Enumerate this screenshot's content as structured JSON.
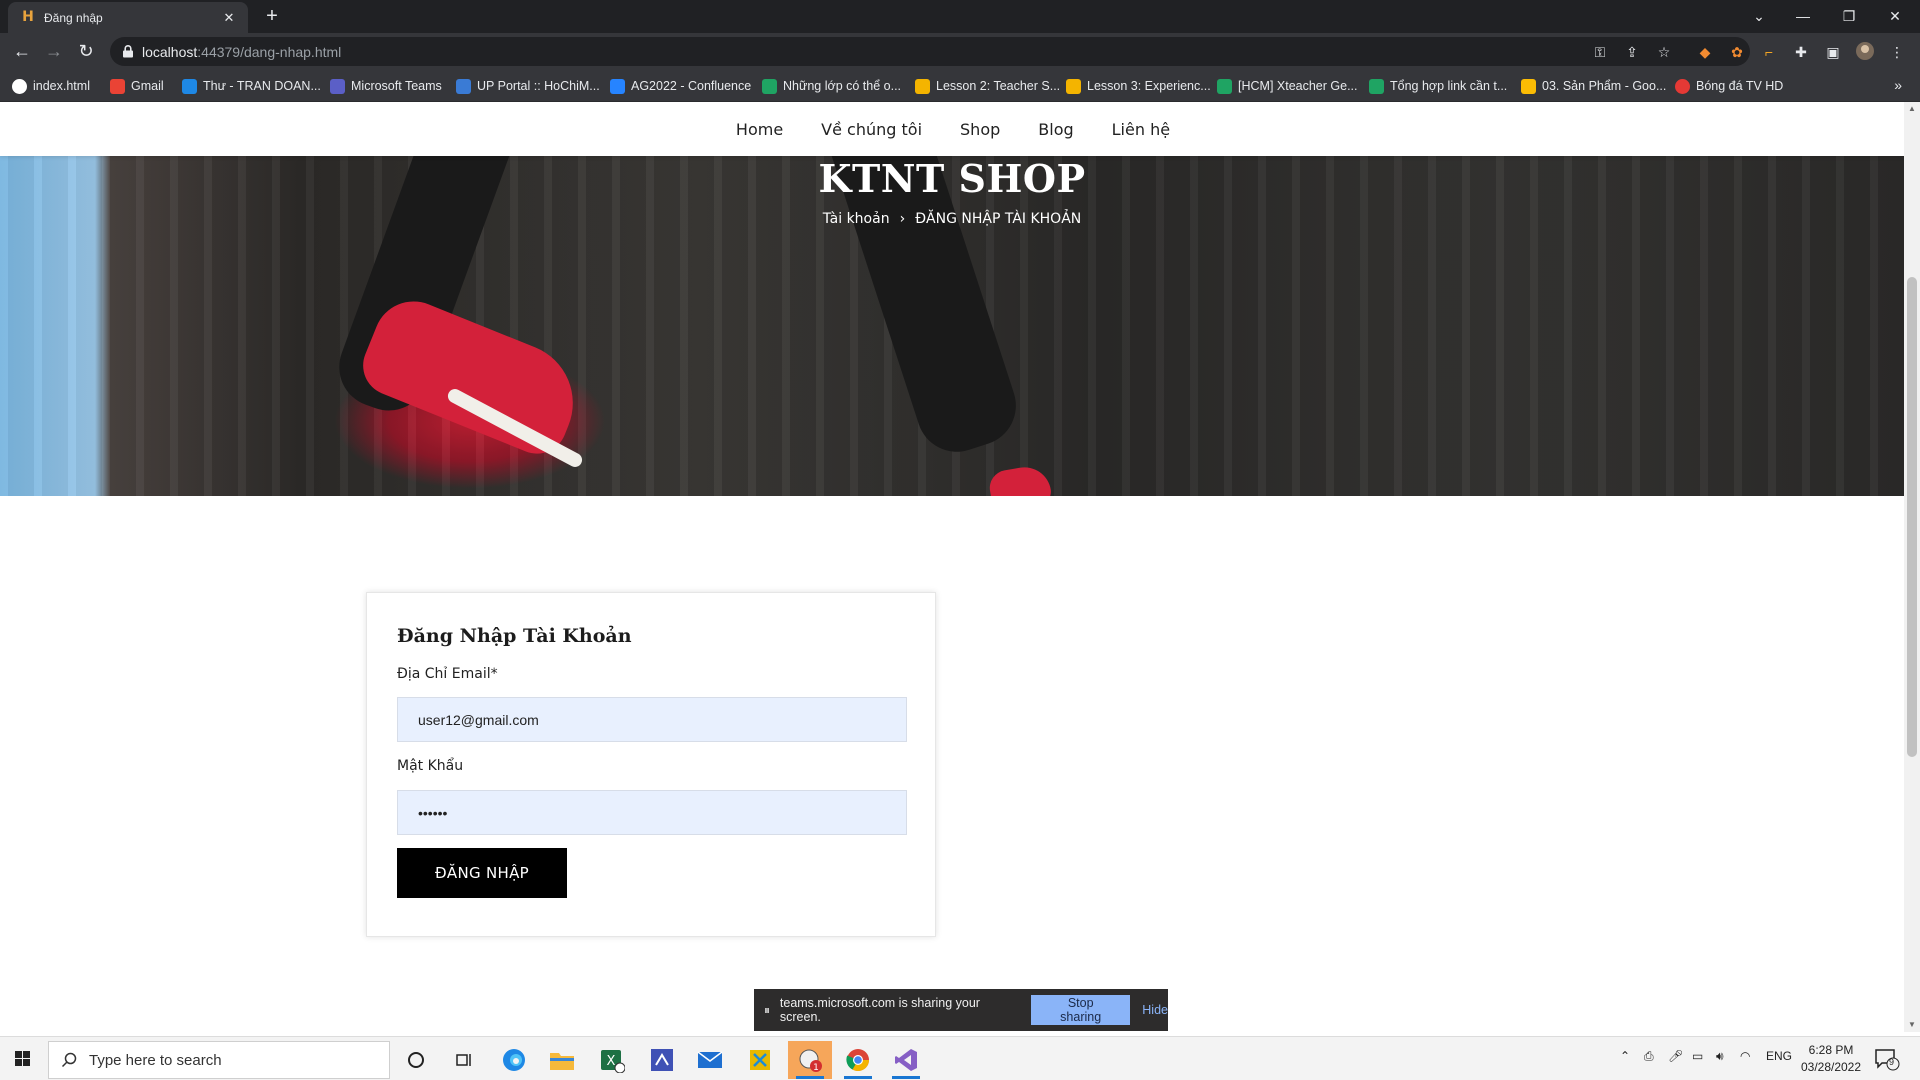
{
  "browser": {
    "tab_title": "Đăng nhập",
    "url_host": "localhost",
    "url_rest": ":44379/dang-nhap.html",
    "bookmarks": [
      {
        "label": "index.html",
        "icon": "github-icon",
        "color": "#ffffff"
      },
      {
        "label": "Gmail",
        "icon": "gmail-icon",
        "color": "#ea4335"
      },
      {
        "label": "Thư - TRAN DOAN...",
        "icon": "outlook-icon",
        "color": "#1e88e5"
      },
      {
        "label": "Microsoft Teams",
        "icon": "teams-icon",
        "color": "#5b5fc7"
      },
      {
        "label": "UP Portal :: HoChiM...",
        "icon": "portal-icon",
        "color": "#3a7bd5"
      },
      {
        "label": "AG2022 - Confluence",
        "icon": "confluence-icon",
        "color": "#2684ff"
      },
      {
        "label": "Những lớp có thể o...",
        "icon": "sheets-icon",
        "color": "#1fa463"
      },
      {
        "label": "Lesson 2: Teacher S...",
        "icon": "slides-icon",
        "color": "#f4b400"
      },
      {
        "label": "Lesson 3: Experienc...",
        "icon": "slides-icon",
        "color": "#f4b400"
      },
      {
        "label": "[HCM] Xteacher Ge...",
        "icon": "sheets-icon",
        "color": "#1fa463"
      },
      {
        "label": "Tổng hợp link cần t...",
        "icon": "sheets-icon",
        "color": "#1fa463"
      },
      {
        "label": "03. Sản Phẩm - Goo...",
        "icon": "drive-icon",
        "color": "#fbbc04"
      },
      {
        "label": "Bóng đá TV HD",
        "icon": "site-icon",
        "color": "#e53935"
      }
    ]
  },
  "nav": {
    "items": [
      "Home",
      "Về chúng tôi",
      "Shop",
      "Blog",
      "Liên hệ"
    ]
  },
  "hero": {
    "title": "KTNT SHOP",
    "crumb_parent": "Tài khoản",
    "crumb_sep": "›",
    "crumb_current": "ĐĂNG NHẬP TÀI KHOẢN"
  },
  "login": {
    "title": "Đăng Nhập Tài Khoản",
    "email_label": "Địa Chỉ Email*",
    "email_value": "user12@gmail.com",
    "password_label": "Mật Khẩu",
    "password_value": "••••••",
    "button_label": "ĐĂNG NHẬP"
  },
  "share_bar": {
    "text": "teams.microsoft.com is sharing your screen.",
    "stop_label": "Stop sharing",
    "hide_label": "Hide"
  },
  "taskbar": {
    "search_placeholder": "Type here to search",
    "language": "ENG",
    "time": "6:28 PM",
    "date": "03/28/2022",
    "notification_count": "9"
  }
}
